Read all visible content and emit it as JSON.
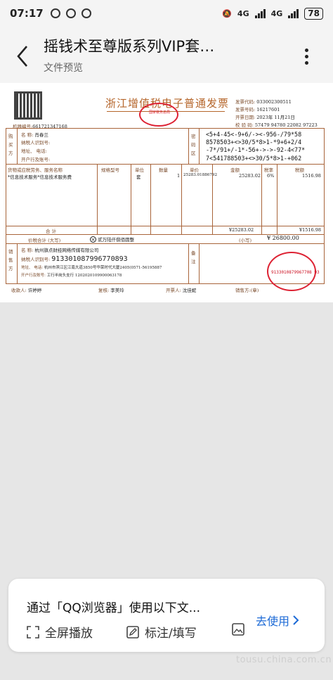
{
  "status_bar": {
    "time": "07:17",
    "network_1": "4G",
    "network_2": "4G",
    "battery": "78"
  },
  "header": {
    "title": "摇钱术至尊版系列VIP套…",
    "subtitle": "文件预览"
  },
  "invoice": {
    "title": "浙江增值税电子普通发票",
    "stamp_top_text": "国家税务总局",
    "machine_no_label": "机器编号:",
    "machine_no": "661721347168",
    "invoice_code_label": "发票代码:",
    "invoice_code": "033002300511",
    "invoice_no_label": "发票号码:",
    "invoice_no": "16217601",
    "date_label": "开票日期:",
    "date": "2023年 11月21日",
    "check_code_label": "校 验 码:",
    "check_code": "57479 94780 22082 97223",
    "buyer_side": "购买方",
    "buyer_name_label": "名    称:",
    "buyer_name": "肖春兰",
    "buyer_taxid_label": "纳税人识别号:",
    "buyer_addr_label": "地址、 电话:",
    "buyer_bank_label": "开户行及账号:",
    "cipher_label": "密码区",
    "cipher_lines": [
      "<5+4-45<-9+6/-><-956-/79*58",
      "8578503+<>30/5*8>1-*9+6+2/4",
      "-7*/91+/-1*-56+->->-92-4<77*",
      "7<541788503+<>30/5*8>1-+062"
    ],
    "col_headers": [
      "货物或应税劳务、服务名称",
      "规格型号",
      "单位",
      "数量",
      "单价",
      "金额",
      "税率",
      "税额"
    ],
    "item": {
      "name": "*信息技术服务*信息技术服务费",
      "unit": "套",
      "qty": "1",
      "price": "25283.01886792",
      "amount": "25283.02",
      "rate": "6%",
      "tax": "1516.98"
    },
    "subtotal_label": "合    计",
    "subtotal_amount": "¥25283.02",
    "subtotal_tax": "¥1516.98",
    "total_label": "价税合计 (大写)",
    "total_words": "贰万陆仟捌佰圆整",
    "total_small_label": "(小写)",
    "total_small": "¥ 26800.00",
    "seller_side": "销售方",
    "seller_name_label": "名    称:",
    "seller_name": "杭州旗点财经网络传媒有限公司",
    "seller_taxid_label": "纳税人识别号:",
    "seller_taxid": "91330108799677089З",
    "seller_addr_label": "地址、 电话:",
    "seller_addr": "杭州市滨江区江南大道3850号华荣时代大厦2405(0571-56195887",
    "seller_bank_label": "开户行及账号:",
    "seller_bank": "工行半岗头支行 1202020109900063178",
    "remarks_label": "备注",
    "stamp_seller_no": "9133010879967708 93",
    "payee_label": "收款人:",
    "payee": "许婷婷",
    "reviewer_label": "复核:",
    "reviewer": "李美玲",
    "issuer_label": "开票人:",
    "issuer": "沈佳妮",
    "seller_sign_label": "销售方:(章)"
  },
  "banner": {
    "title": "通过「QQ浏览器」使用以下文...",
    "use_label": "去使用",
    "actions": [
      {
        "label": "全屏播放",
        "icon": "fullscreen-icon"
      },
      {
        "label": "标注/填写",
        "icon": "annotate-icon"
      },
      {
        "label": "",
        "icon": "picture-icon"
      }
    ]
  },
  "watermark": "tousu.china.com.cn"
}
